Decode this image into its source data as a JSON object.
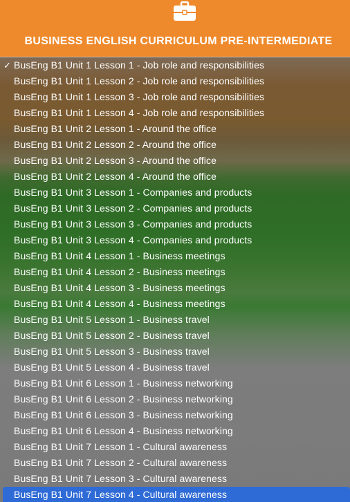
{
  "header": {
    "icon": "briefcase-icon",
    "title": "BUSINESS ENGLISH CURRICULUM PRE-INTERMEDIATE"
  },
  "menu": {
    "checked_index": 0,
    "selected_index": 27,
    "items": [
      "BusEng B1 Unit 1 Lesson 1 - Job role and responsibilities",
      "BusEng B1 Unit 1 Lesson 2 - Job role and responsibilities",
      "BusEng B1 Unit 1 Lesson 3 - Job role and responsibilities",
      "BusEng B1 Unit 1 Lesson 4 - Job role and responsibilities",
      "BusEng B1 Unit 2 Lesson 1 - Around the office",
      "BusEng B1 Unit 2 Lesson 2 - Around the office",
      "BusEng B1 Unit 2 Lesson 3 - Around the office",
      "BusEng B1 Unit 2 Lesson 4 - Around the office",
      "BusEng B1 Unit 3 Lesson 1 - Companies and products",
      "BusEng B1 Unit 3 Lesson 2 - Companies and products",
      "BusEng B1 Unit 3 Lesson 3 - Companies and products",
      "BusEng B1 Unit 3 Lesson 4 - Companies and products",
      "BusEng B1 Unit 4 Lesson 1 - Business meetings",
      "BusEng B1 Unit 4 Lesson 2 - Business meetings",
      "BusEng B1 Unit 4 Lesson 3 - Business meetings",
      "BusEng B1 Unit 4 Lesson 4 - Business meetings",
      "BusEng B1 Unit 5 Lesson 1 - Business travel",
      "BusEng B1 Unit 5 Lesson 2 - Business travel",
      "BusEng B1 Unit 5 Lesson 3 - Business travel",
      "BusEng B1 Unit 5 Lesson 4 - Business travel",
      "BusEng B1 Unit 6 Lesson 1 - Business networking",
      "BusEng B1 Unit 6 Lesson 2 - Business networking",
      "BusEng B1 Unit 6 Lesson 3 - Business networking",
      "BusEng B1 Unit 6 Lesson 4 - Business networking",
      "BusEng B1 Unit 7 Lesson 1 - Cultural awareness",
      "BusEng B1 Unit 7 Lesson 2 - Cultural awareness",
      "BusEng B1 Unit 7 Lesson 3 - Cultural awareness",
      "BusEng B1 Unit 7 Lesson 4 - Cultural awareness"
    ]
  },
  "colors": {
    "header_bg": "#ef8a2c",
    "selection_bg": "#2f6bd6",
    "text": "#ffffff"
  }
}
